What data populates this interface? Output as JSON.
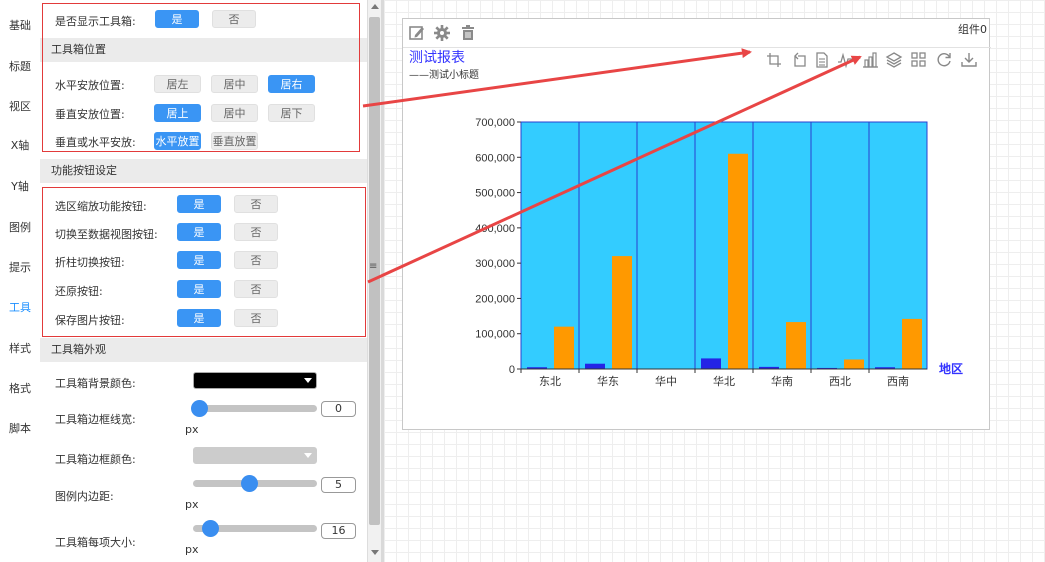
{
  "sidebar": {
    "items": [
      {
        "label": "基础"
      },
      {
        "label": "标题"
      },
      {
        "label": "视区"
      },
      {
        "label": "X轴"
      },
      {
        "label": "Y轴"
      },
      {
        "label": "图例"
      },
      {
        "label": "提示"
      },
      {
        "label": "工具"
      },
      {
        "label": "样式"
      },
      {
        "label": "格式"
      },
      {
        "label": "脚本"
      }
    ],
    "active": "工具"
  },
  "panel": {
    "show_toolbox": {
      "label": "是否显示工具箱:",
      "yes": "是",
      "no": "否",
      "selected": "是"
    },
    "position_section": "工具箱位置",
    "h_pos": {
      "label": "水平安放位置:",
      "options": [
        "居左",
        "居中",
        "居右"
      ],
      "selected": "居右"
    },
    "v_pos": {
      "label": "垂直安放位置:",
      "options": [
        "居上",
        "居中",
        "居下"
      ],
      "selected": "居上"
    },
    "orient": {
      "label": "垂直或水平安放:",
      "options": [
        "水平放置",
        "垂直放置"
      ],
      "selected": "水平放置"
    },
    "func_section": "功能按钮设定",
    "func_buttons": [
      {
        "label": "选区缩放功能按钮:",
        "yes": "是",
        "no": "否",
        "selected": "是"
      },
      {
        "label": "切换至数据视图按钮:",
        "yes": "是",
        "no": "否",
        "selected": "是"
      },
      {
        "label": "折柱切换按钮:",
        "yes": "是",
        "no": "否",
        "selected": "是"
      },
      {
        "label": "还原按钮:",
        "yes": "是",
        "no": "否",
        "selected": "是"
      },
      {
        "label": "保存图片按钮:",
        "yes": "是",
        "no": "否",
        "selected": "是"
      }
    ],
    "appearance_section": "工具箱外观",
    "bg_color": {
      "label": "工具箱背景颜色:",
      "value": "#000000"
    },
    "border_width": {
      "label": "工具箱边框线宽:",
      "value": "0",
      "unit": "px",
      "fraction": 0.0
    },
    "border_color": {
      "label": "工具箱边框颜色:",
      "value": "#cccccc"
    },
    "padding": {
      "label": "图例内边距:",
      "value": "5",
      "unit": "px",
      "fraction": 0.45
    },
    "item_size": {
      "label": "工具箱每项大小:",
      "value": "16",
      "unit": "px",
      "fraction": 0.1
    }
  },
  "component": {
    "name": "组件0",
    "toolbar_icons": [
      "edit-icon",
      "gear-icon",
      "trash-icon"
    ],
    "toolbox_icons": [
      "zoom-select-icon",
      "zoom-reset-icon",
      "data-view-icon",
      "line-toggle-icon",
      "bar-toggle-icon",
      "stack-icon",
      "tiled-icon",
      "restore-icon",
      "save-image-icon"
    ]
  },
  "chart_data": {
    "type": "bar",
    "title": "测试报表",
    "subtitle": "——测试小标题",
    "xlabel": "地区",
    "categories": [
      "东北",
      "华东",
      "华中",
      "华北",
      "华南",
      "西北",
      "西南"
    ],
    "series": [
      {
        "values": [
          5000,
          15000,
          0,
          30000,
          6000,
          3000,
          5000
        ],
        "color": "#2424e6"
      },
      {
        "values": [
          120000,
          320000,
          0,
          610000,
          133000,
          27000,
          142000
        ],
        "color": "#ff9900"
      }
    ],
    "ylim": [
      0,
      700000
    ],
    "yticks": [
      "0",
      "100,000",
      "200,000",
      "300,000",
      "400,000",
      "500,000",
      "600,000",
      "700,000"
    ],
    "plot_bg": "#33ccff",
    "grid": true
  },
  "colors": {
    "accent": "#3a95f4",
    "highlight_border": "#e23a3a",
    "title": "#3333ff"
  }
}
